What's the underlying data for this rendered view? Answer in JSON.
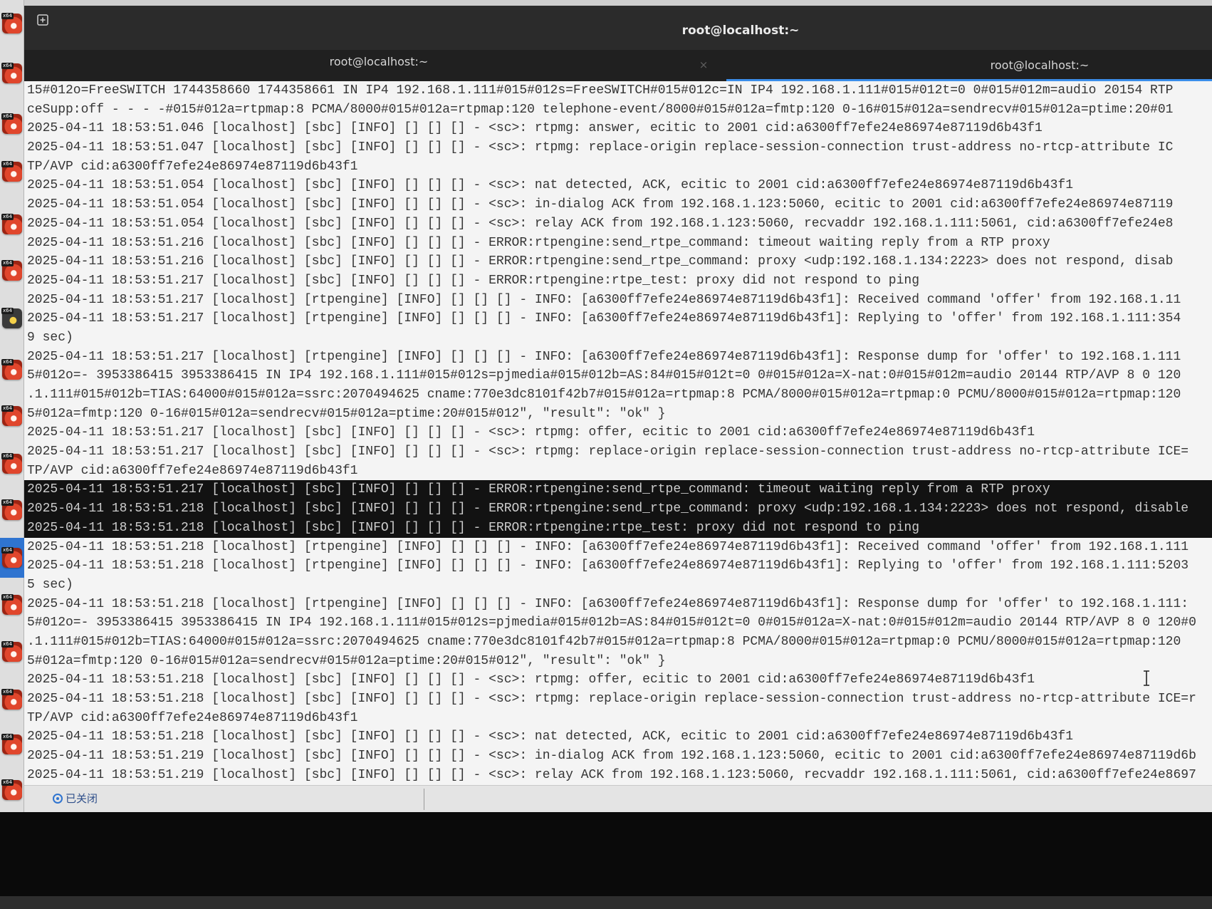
{
  "window": {
    "title": "root@localhost:~",
    "new_tab_icon": "new-tab-icon"
  },
  "tabs": [
    {
      "label": "root@localhost:~",
      "close": "×"
    },
    {
      "label": "root@localhost:~",
      "active": true
    }
  ],
  "dock": {
    "badge": "x64",
    "items": [
      "x64-app-icon",
      "x64-app-icon",
      "x64-app-icon",
      "x64-app-icon",
      "x64-app-icon",
      "x64-app-icon",
      "dark-app-icon",
      "x64-app-icon",
      "x64-app-icon",
      "x64-app-icon",
      "x64-app-icon",
      "x64-app-icon",
      "x64-app-icon",
      "x64-app-icon",
      "x64-app-icon",
      "x64-app-icon",
      "x64-app-icon"
    ]
  },
  "terminal": {
    "lines": [
      "15#012o=FreeSWITCH 1744358660 1744358661 IN IP4 192.168.1.111#015#012s=FreeSWITCH#015#012c=IN IP4 192.168.1.111#015#012t=0 0#015#012m=audio 20154 RTP",
      "ceSupp:off - - - -#015#012a=rtpmap:8 PCMA/8000#015#012a=rtpmap:120 telephone-event/8000#015#012a=fmtp:120 0-16#015#012a=sendrecv#015#012a=ptime:20#01",
      "2025-04-11 18:53:51.046 [localhost] [sbc] [INFO] [] [] [] - <sc>: rtpmg: answer, ecitic to 2001 cid:a6300ff7efe24e86974e87119d6b43f1",
      "2025-04-11 18:53:51.047 [localhost] [sbc] [INFO] [] [] [] - <sc>: rtpmg: replace-origin replace-session-connection trust-address no-rtcp-attribute IC",
      "TP/AVP cid:a6300ff7efe24e86974e87119d6b43f1",
      "2025-04-11 18:53:51.054 [localhost] [sbc] [INFO] [] [] [] - <sc>: nat detected, ACK, ecitic to 2001 cid:a6300ff7efe24e86974e87119d6b43f1",
      "2025-04-11 18:53:51.054 [localhost] [sbc] [INFO] [] [] [] - <sc>: in-dialog ACK from 192.168.1.123:5060, ecitic to 2001 cid:a6300ff7efe24e86974e87119",
      "2025-04-11 18:53:51.054 [localhost] [sbc] [INFO] [] [] [] - <sc>: relay ACK from 192.168.1.123:5060, recvaddr 192.168.1.111:5061, cid:a6300ff7efe24e8",
      "2025-04-11 18:53:51.216 [localhost] [sbc] [INFO] [] [] [] - ERROR:rtpengine:send_rtpe_command: timeout waiting reply from a RTP proxy",
      "2025-04-11 18:53:51.216 [localhost] [sbc] [INFO] [] [] [] - ERROR:rtpengine:send_rtpe_command: proxy <udp:192.168.1.134:2223> does not respond, disab",
      "2025-04-11 18:53:51.217 [localhost] [sbc] [INFO] [] [] [] - ERROR:rtpengine:rtpe_test: proxy did not respond to ping",
      "2025-04-11 18:53:51.217 [localhost] [rtpengine] [INFO] [] [] [] - INFO: [a6300ff7efe24e86974e87119d6b43f1]: Received command 'offer' from 192.168.1.11",
      "2025-04-11 18:53:51.217 [localhost] [rtpengine] [INFO] [] [] [] - INFO: [a6300ff7efe24e86974e87119d6b43f1]: Replying to 'offer' from 192.168.1.111:354",
      "9 sec)",
      "2025-04-11 18:53:51.217 [localhost] [rtpengine] [INFO] [] [] [] - INFO: [a6300ff7efe24e86974e87119d6b43f1]: Response dump for 'offer' to 192.168.1.111",
      "5#012o=- 3953386415 3953386415 IN IP4 192.168.1.111#015#012s=pjmedia#015#012b=AS:84#015#012t=0 0#015#012a=X-nat:0#015#012m=audio 20144 RTP/AVP 8 0 120",
      ".1.111#015#012b=TIAS:64000#015#012a=ssrc:2070494625 cname:770e3dc8101f42b7#015#012a=rtpmap:8 PCMA/8000#015#012a=rtpmap:0 PCMU/8000#015#012a=rtpmap:120",
      "5#012a=fmtp:120 0-16#015#012a=sendrecv#015#012a=ptime:20#015#012\", \"result\": \"ok\" }",
      "2025-04-11 18:53:51.217 [localhost] [sbc] [INFO] [] [] [] - <sc>: rtpmg: offer, ecitic to 2001 cid:a6300ff7efe24e86974e87119d6b43f1",
      "2025-04-11 18:53:51.217 [localhost] [sbc] [INFO] [] [] [] - <sc>: rtpmg: replace-origin replace-session-connection trust-address no-rtcp-attribute ICE=",
      "TP/AVP cid:a6300ff7efe24e86974e87119d6b43f1",
      "2025-04-11 18:53:51.217 [localhost] [sbc] [INFO] [] [] [] - ERROR:rtpengine:send_rtpe_command: timeout waiting reply from a RTP proxy",
      "2025-04-11 18:53:51.218 [localhost] [sbc] [INFO] [] [] [] - ERROR:rtpengine:send_rtpe_command: proxy <udp:192.168.1.134:2223> does not respond, disable",
      "2025-04-11 18:53:51.218 [localhost] [sbc] [INFO] [] [] [] - ERROR:rtpengine:rtpe_test: proxy did not respond to ping",
      "2025-04-11 18:53:51.218 [localhost] [rtpengine] [INFO] [] [] [] - INFO: [a6300ff7efe24e86974e87119d6b43f1]: Received command 'offer' from 192.168.1.111",
      "2025-04-11 18:53:51.218 [localhost] [rtpengine] [INFO] [] [] [] - INFO: [a6300ff7efe24e86974e87119d6b43f1]: Replying to 'offer' from 192.168.1.111:5203",
      "5 sec)",
      "2025-04-11 18:53:51.218 [localhost] [rtpengine] [INFO] [] [] [] - INFO: [a6300ff7efe24e86974e87119d6b43f1]: Response dump for 'offer' to 192.168.1.111:",
      "5#012o=- 3953386415 3953386415 IN IP4 192.168.1.111#015#012s=pjmedia#015#012b=AS:84#015#012t=0 0#015#012a=X-nat:0#015#012m=audio 20144 RTP/AVP 8 0 120#0",
      ".1.111#015#012b=TIAS:64000#015#012a=ssrc:2070494625 cname:770e3dc8101f42b7#015#012a=rtpmap:8 PCMA/8000#015#012a=rtpmap:0 PCMU/8000#015#012a=rtpmap:120",
      "5#012a=fmtp:120 0-16#015#012a=sendrecv#015#012a=ptime:20#015#012\", \"result\": \"ok\" }",
      "2025-04-11 18:53:51.218 [localhost] [sbc] [INFO] [] [] [] - <sc>: rtpmg: offer, ecitic to 2001 cid:a6300ff7efe24e86974e87119d6b43f1",
      "2025-04-11 18:53:51.218 [localhost] [sbc] [INFO] [] [] [] - <sc>: rtpmg: replace-origin replace-session-connection trust-address no-rtcp-attribute ICE=r",
      "TP/AVP cid:a6300ff7efe24e86974e87119d6b43f1",
      "2025-04-11 18:53:51.218 [localhost] [sbc] [INFO] [] [] [] - <sc>: nat detected, ACK, ecitic to 2001 cid:a6300ff7efe24e86974e87119d6b43f1",
      "2025-04-11 18:53:51.219 [localhost] [sbc] [INFO] [] [] [] - <sc>: in-dialog ACK from 192.168.1.123:5060, ecitic to 2001 cid:a6300ff7efe24e86974e87119d6b",
      "2025-04-11 18:53:51.219 [localhost] [sbc] [INFO] [] [] [] - <sc>: relay ACK from 192.168.1.123:5060, recvaddr 192.168.1.111:5061, cid:a6300ff7efe24e8697"
    ]
  },
  "status": {
    "icon": "closed-status-icon",
    "text": "已关闭"
  },
  "colors": {
    "accent": "#3b8eea",
    "terminal_bg": "#f4f4f4",
    "terminal_fg": "#353535",
    "selection_bg": "#121212",
    "titlebar_bg": "#2b2b2b"
  }
}
